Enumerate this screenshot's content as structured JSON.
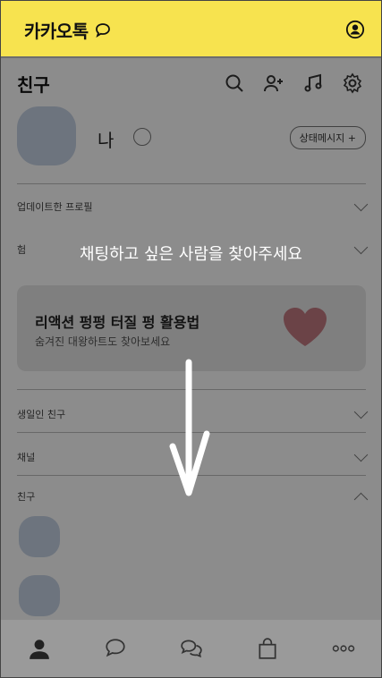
{
  "app": {
    "title": "카카오톡",
    "accent": "#f7e34f"
  },
  "header": {
    "title": "친구",
    "icons": [
      "search-icon",
      "add-friend-icon",
      "music-icon",
      "settings-icon"
    ]
  },
  "me": {
    "name": "나",
    "status_button": "상태메시지 +"
  },
  "sections": {
    "updated_profiles": "업데이트한 프로필",
    "birthday_friends": "생일인 친구",
    "channels": "채널",
    "friends": "친구",
    "hidden_item": "험"
  },
  "banner": {
    "title": "리액션 펑펑 터질 펑 활용법",
    "subtitle": "숨겨진 대왕하트도 찾아보세요"
  },
  "overlay": {
    "message": "채팅하고 싶은 사람을 찾아주세요"
  },
  "bottom_nav": {
    "tabs": [
      "friends-tab",
      "chats-tab",
      "openchat-tab",
      "shopping-tab",
      "more-tab"
    ]
  }
}
